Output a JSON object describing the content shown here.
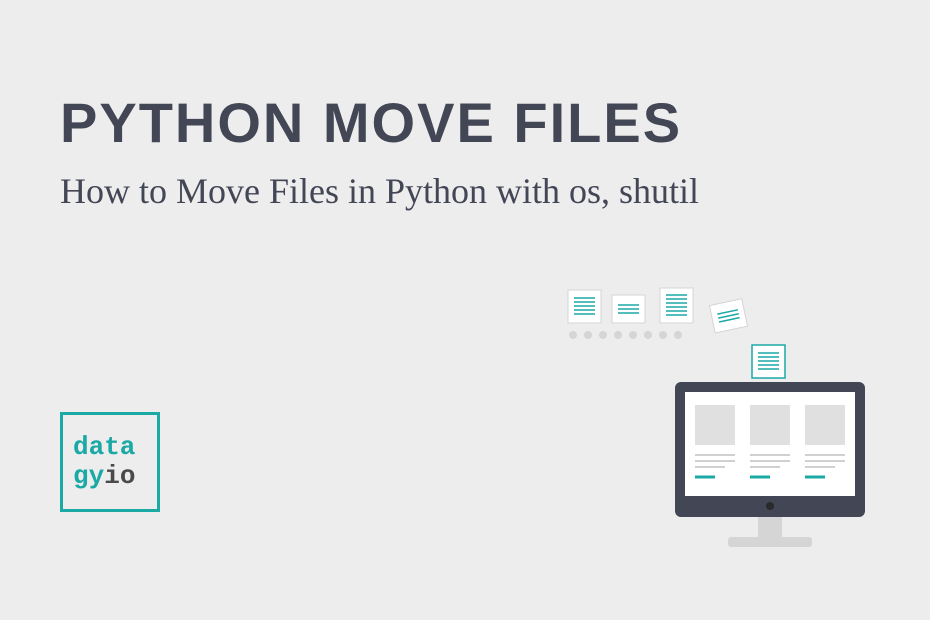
{
  "header": {
    "title": "PYTHON MOVE FILES",
    "subtitle": "How to Move Files in Python with os, shutil"
  },
  "logo": {
    "line1": "data",
    "line2_part1": "gy",
    "line2_part2": "io"
  },
  "colors": {
    "teal": "#1aa9a5",
    "dark": "#434655",
    "background": "#eeedee"
  }
}
